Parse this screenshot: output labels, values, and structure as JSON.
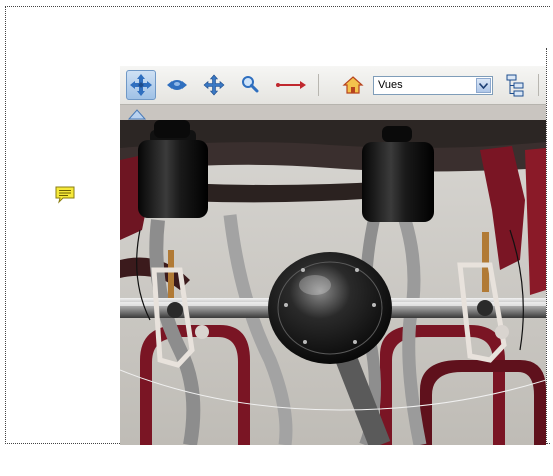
{
  "toolbar": {
    "tools": [
      {
        "name": "rotate-tool",
        "icon": "rotate-arrows-icon",
        "active": true
      },
      {
        "name": "spin-tool",
        "icon": "spin-icon",
        "active": false
      },
      {
        "name": "pan-tool",
        "icon": "pan-arrows-icon",
        "active": false
      },
      {
        "name": "zoom-tool",
        "icon": "magnifier-icon",
        "active": false
      },
      {
        "name": "walk-tool",
        "icon": "walk-arrow-icon",
        "active": false
      }
    ],
    "home_icon": "home-icon",
    "model_tree_icon": "model-tree-icon"
  },
  "views": {
    "selected": "Vues"
  },
  "colors": {
    "toolbar_bg": "#ebeae6",
    "active_tool": "#a9c8ea",
    "tool_blue": "#3a78c3",
    "note_yellow": "#f6e93a",
    "frame_red": "#8a1a28",
    "metal_dark": "#1a1a1a"
  },
  "annotation": {
    "icon": "comment-note-icon"
  }
}
